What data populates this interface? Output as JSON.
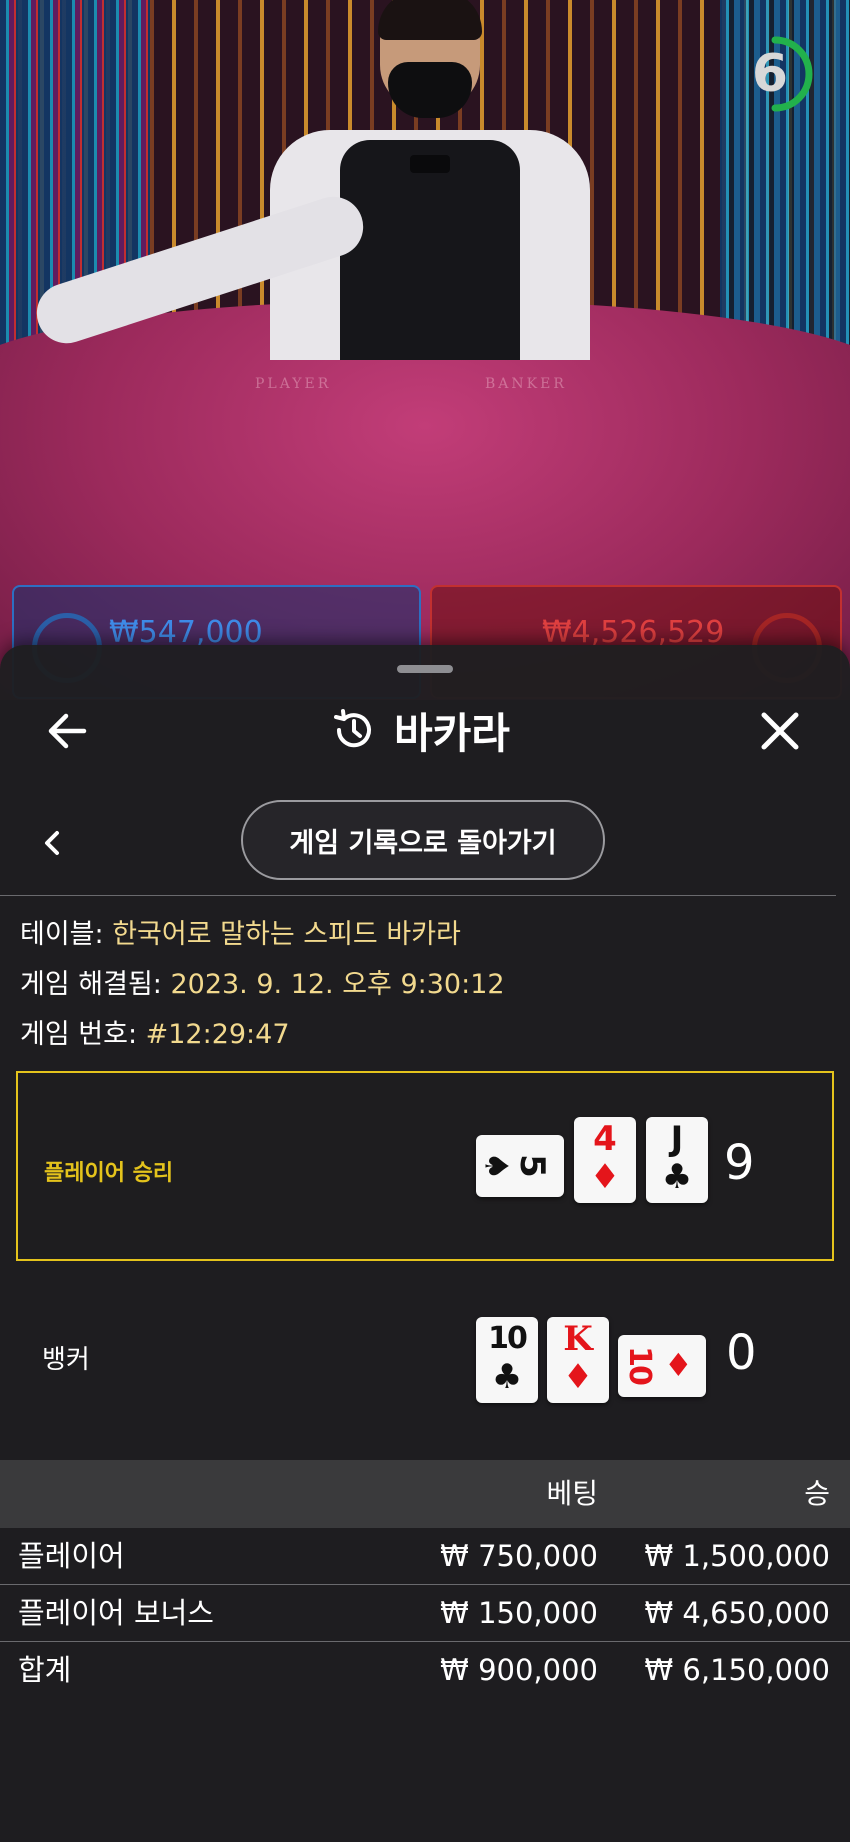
{
  "video": {
    "table_labels": [
      "PLAYER",
      "BANKER"
    ],
    "timer_value": "6"
  },
  "bet_bar": {
    "player_amount": "₩547,000",
    "banker_amount": "₩4,526,529"
  },
  "sheet": {
    "title": "바카라",
    "back_to_history_label": "게임 기록으로 돌아가기",
    "info": [
      {
        "key": "테이블: ",
        "value": "한국어로 말하는 스피드 바카라"
      },
      {
        "key": "게임 해결됨: ",
        "value": "2023. 9. 12. 오후 9:30:12"
      },
      {
        "key": "게임 번호: ",
        "value": "#12:29:47"
      }
    ],
    "player_result": {
      "label": "플레이어 승리",
      "score": "9",
      "cards": [
        {
          "rank": "5",
          "suit": "♠",
          "color": "black",
          "orientation": "sideways"
        },
        {
          "rank": "4",
          "suit": "♦",
          "color": "red",
          "orientation": "upright"
        },
        {
          "rank": "J",
          "suit": "♣",
          "color": "black",
          "orientation": "upright"
        }
      ]
    },
    "banker_result": {
      "label": "뱅커",
      "score": "0",
      "cards": [
        {
          "rank": "10",
          "suit": "♣",
          "color": "black",
          "orientation": "upright"
        },
        {
          "rank": "K",
          "suit": "♦",
          "color": "red",
          "orientation": "upright"
        },
        {
          "rank": "10",
          "suit": "♦",
          "color": "red",
          "orientation": "sideways"
        }
      ]
    },
    "bet_table": {
      "headers": {
        "bet": "베팅",
        "win": "승"
      },
      "rows": [
        {
          "name": "플레이어",
          "bet": "₩ 750,000",
          "win": "₩ 1,500,000"
        },
        {
          "name": "플레이어 보너스",
          "bet": "₩ 150,000",
          "win": "₩ 4,650,000"
        }
      ],
      "total": {
        "name": "합계",
        "bet": "₩ 900,000",
        "win": "₩ 6,150,000"
      }
    }
  },
  "colors": {
    "accent_gold": "#e4c31c",
    "info_value": "#f2d98e",
    "player_blue": "#2d6fc2",
    "banker_red": "#c23030",
    "timer_green": "#22b14c"
  },
  "icons": [
    "arrow-left-icon",
    "history-icon",
    "close-icon",
    "chevron-left-icon"
  ]
}
